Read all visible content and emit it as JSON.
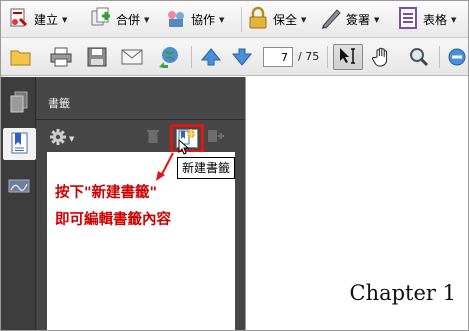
{
  "toolbar_main": {
    "items": [
      {
        "label": "建立",
        "icon": "create-pdf-icon"
      },
      {
        "label": "合併",
        "icon": "combine-icon"
      },
      {
        "label": "協作",
        "icon": "collaborate-icon"
      },
      {
        "label": "保全",
        "icon": "lock-icon"
      },
      {
        "label": "簽署",
        "icon": "pen-icon"
      },
      {
        "label": "表格",
        "icon": "form-icon"
      }
    ]
  },
  "toolbar_nav": {
    "page_current": "7",
    "page_total": "/ 75"
  },
  "left_tabs": [
    "pages-tab-icon",
    "bookmarks-tab-icon",
    "signatures-tab-icon"
  ],
  "bookmarks_panel": {
    "title": "書籤",
    "tooltip": "新建書籤"
  },
  "annotation": {
    "line1": "按下\"新建書籤\"",
    "line2": "即可編輯書籤內容",
    "color": "#d00000"
  },
  "document": {
    "chapter_text": "Chapter 1"
  }
}
